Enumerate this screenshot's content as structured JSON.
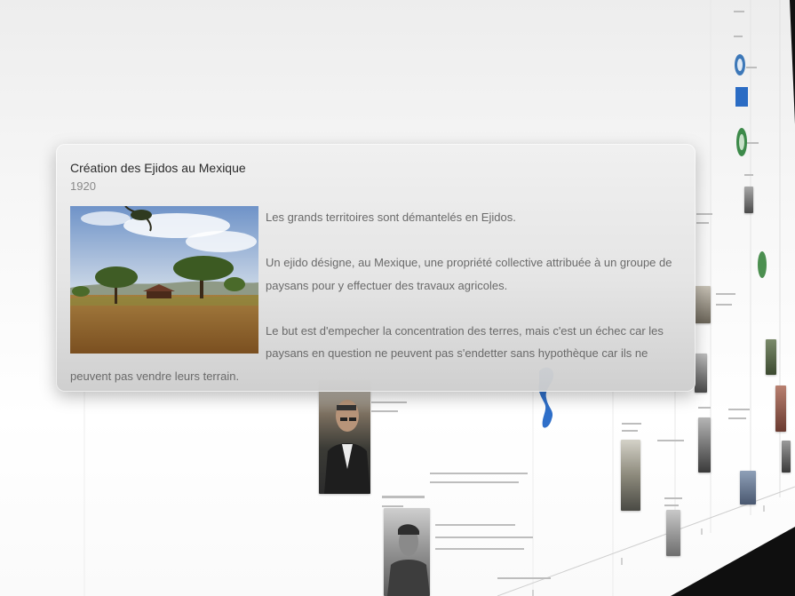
{
  "event_card": {
    "title": "Création des Ejidos au Mexique",
    "year": "1920",
    "image": "landscape-photo",
    "paragraphs": [
      "Les grands territoires sont démantelés en Ejidos.",
      "Un ejido désigne, au Mexique, une propriété collective attribuée à un groupe de paysans pour y effectuer des travaux agricoles.",
      "Le but est d'empecher la concentration des terres, mais c'est un échec car les paysans en question ne peuvent pas s'endetter sans hypothèque car ils ne peuvent pas vendre leurs terrain."
    ]
  },
  "colors": {
    "card_bg": "#e6e6e6",
    "title": "#2a2a2a",
    "year": "#8a8a8a",
    "body": "#6a6a6a",
    "dark_corner": "#0f0f0f"
  }
}
